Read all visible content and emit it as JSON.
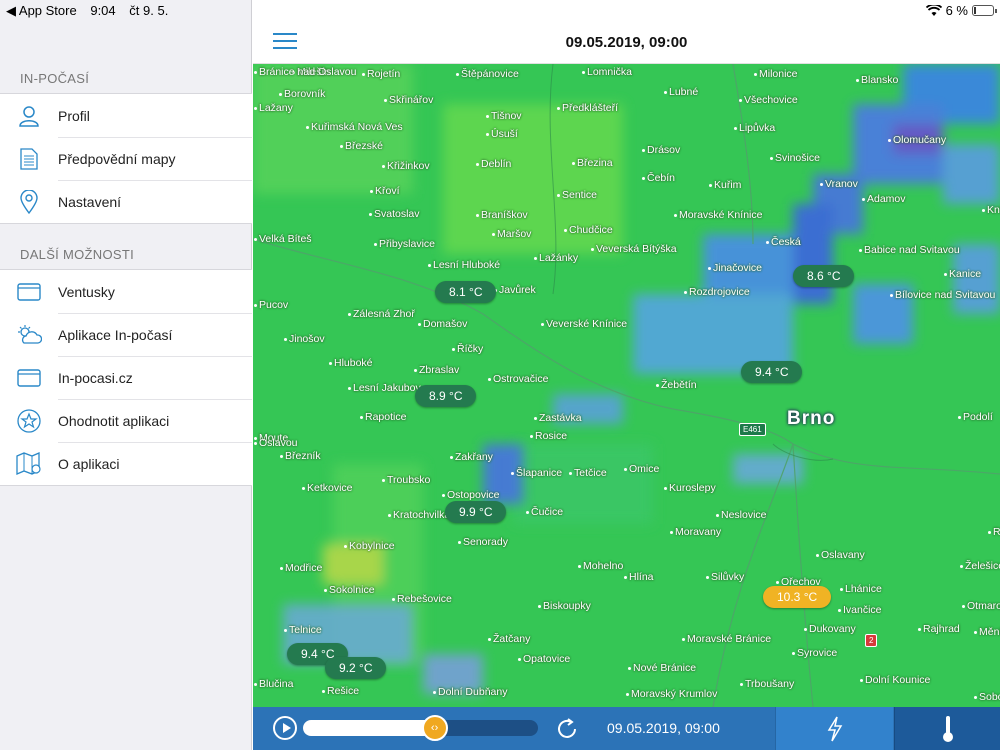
{
  "status_bar": {
    "back_app": "◀ App Store",
    "time": "9:04",
    "date": "čt 9. 5.",
    "battery": "6 %"
  },
  "sidebar": {
    "section1_title": "IN-POČASÍ",
    "section1_items": [
      {
        "label": "Profil",
        "icon": "person-icon"
      },
      {
        "label": "Předpovědní mapy",
        "icon": "document-icon"
      },
      {
        "label": "Nastavení",
        "icon": "location-pin-icon"
      }
    ],
    "section2_title": "DALŠÍ MOŽNOSTI",
    "section2_items": [
      {
        "label": "Ventusky",
        "icon": "browser-window-icon"
      },
      {
        "label": "Aplikace In-počasí",
        "icon": "weather-cloud-sun-icon"
      },
      {
        "label": "In-pocasi.cz",
        "icon": "browser-window-icon"
      },
      {
        "label": "Ohodnotit aplikaci",
        "icon": "star-icon"
      },
      {
        "label": "O aplikaci",
        "icon": "map-info-icon"
      }
    ]
  },
  "header": {
    "title": "09.05.2019, 09:00"
  },
  "map": {
    "city": "Brno",
    "towns": [
      "Milešín",
      "Rojetín",
      "Štěpánovice",
      "Lomnička",
      "Milonice",
      "Blansko",
      "Borovník",
      "Skřinářov",
      "Lubné",
      "Všechovice",
      "Lažany",
      "Tišnov",
      "Předklášteří",
      "Kuřimská Nová Ves",
      "Úsuší",
      "Lipůvka",
      "Olomučany",
      "Březské",
      "Deblín",
      "Drásov",
      "Svinošice",
      "Křižinkov",
      "Březina",
      "Čebín",
      "Kuřim",
      "Vranov",
      "Křoví",
      "Sentice",
      "Adamov",
      "Svatoslav",
      "Braníškov",
      "Moravské Knínice",
      "Chudčice",
      "Kníte",
      "Velká Bíteš",
      "Maršov",
      "Česká",
      "Babice nad Svitavou",
      "Přibyslavice",
      "Veverská Bítýška",
      "Lažánky",
      "Lesní Hluboké",
      "Jinačovice",
      "Kanice",
      "Javůrek",
      "Rozdrojovice",
      "Bílovice nad Svitavou",
      "Pucov",
      "Zálesná Zhoř",
      "Veverské Knínice",
      "Domašov",
      "Jinošov",
      "Říčky",
      "Hluboké",
      "Zbraslav",
      "Ostrovačice",
      "Žebětín",
      "Lesní Jakubov",
      "Rapotice",
      "Zastávka",
      "Podolí",
      "Rosice",
      "Březník",
      "Zakřany",
      "Šlapanice",
      "Tetčice",
      "Omice",
      "Troubsko",
      "Ketkovice",
      "Kuroslepy",
      "Ostopovice",
      "Kratochvilka",
      "Čučice",
      "Neslovice",
      "Moravany",
      "Radostice",
      "Kobylnice",
      "Senorady",
      "Oslavany",
      "Modřice",
      "Mohelno",
      "Hlína",
      "Silůvky",
      "Ořechov",
      "Želešice",
      "Sokolnice",
      "Lhánice",
      "Rebešovice",
      "Biskoupky",
      "Ivančice",
      "Otmarov",
      "Telnice",
      "Dukovany",
      "Rajhrad",
      "Měnín",
      "Žatčany",
      "Moravské Bránice",
      "Syrovice",
      "Opatovice",
      "Nové Bránice",
      "Dolní Kounice",
      "Blučina",
      "Rešice",
      "Dolní Dubňany",
      "Moravský Krumlov",
      "Trboušany",
      "Sobotovice",
      "Moute",
      "Oslavou",
      "Bránice nad Oslavou"
    ],
    "road_signs": [
      "E461",
      "2"
    ],
    "temperature_labels": [
      "8.1 °C",
      "8.6 °C",
      "9.4 °C",
      "8.9 °C",
      "9.9 °C",
      "10.3 °C",
      "9.4 °C",
      "9.2 °C"
    ]
  },
  "bottom_bar": {
    "time": "09.05.2019, 09:00",
    "timeline_progress": 0.56,
    "knob_label": "‹›",
    "wind_tab_icon": "lightning-icon",
    "temp_tab_icon": "thermometer-icon"
  },
  "colors": {
    "accent": "#2c73b7",
    "map_green": "#35c655",
    "rain_blue": "#4a6ee8",
    "warm_label": "#f0b324",
    "temp_label": "#247a4f"
  }
}
